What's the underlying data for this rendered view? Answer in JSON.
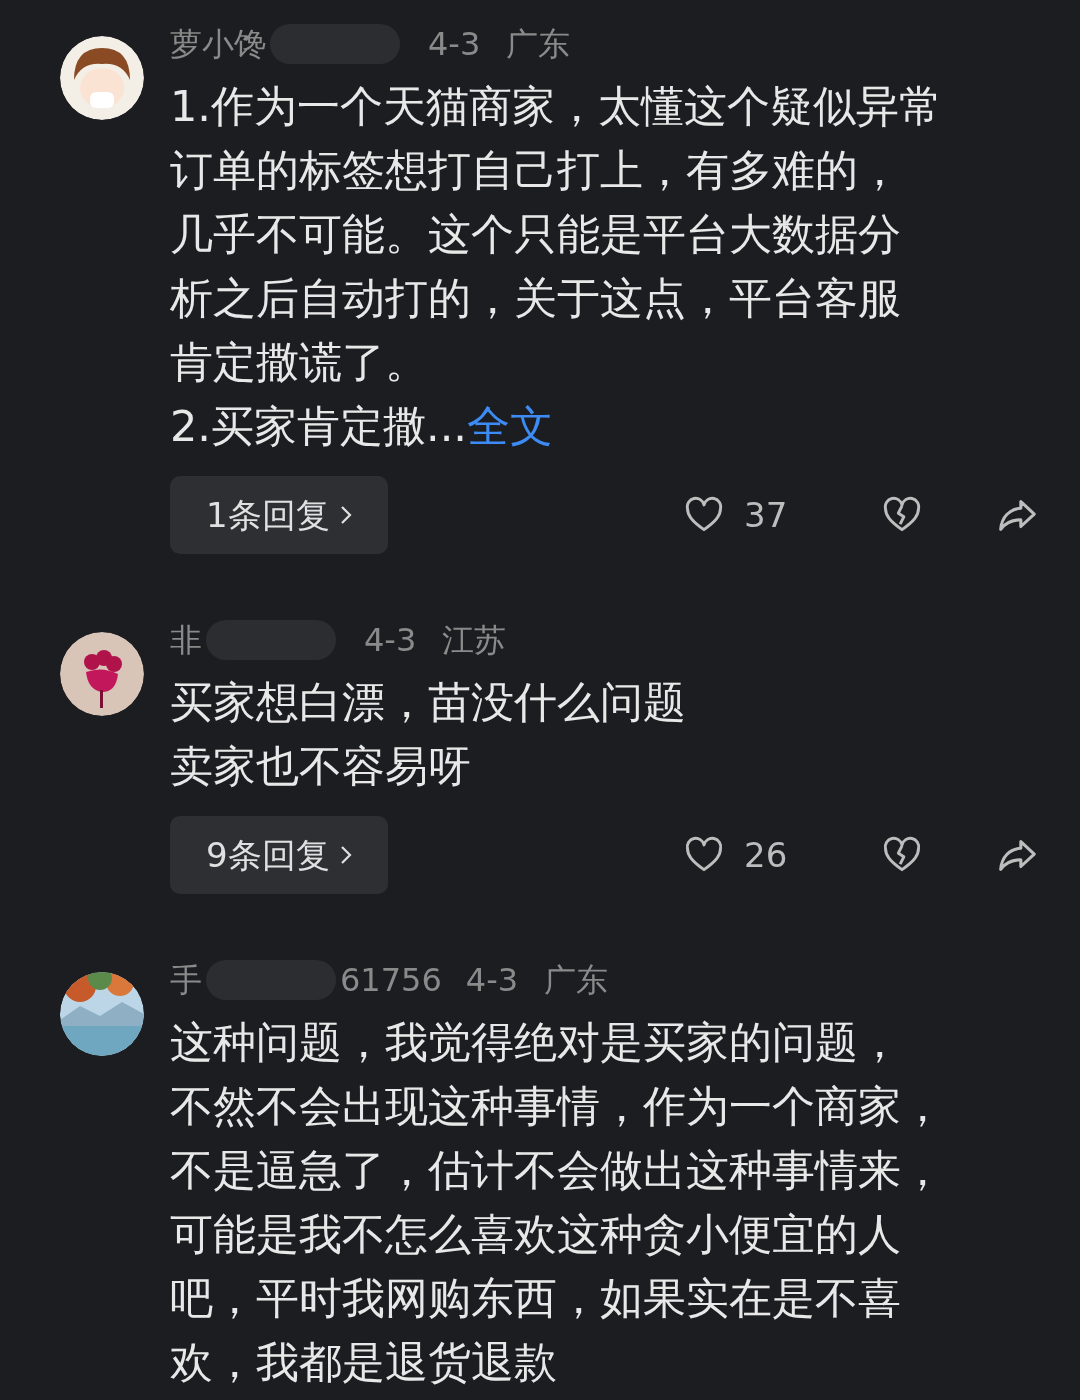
{
  "comments": [
    {
      "avatar": {
        "kind": "girl"
      },
      "user_name": "萝小馋",
      "date": "4-3",
      "region": "广东",
      "body_lines": [
        "1.作为一个天猫商家，太懂这个疑似异常",
        "订单的标签想打自己打上，有多难的，",
        "几乎不可能。这个只能是平台大数据分",
        "析之后自动打的，关于这点，平台客服",
        "肯定撒谎了。",
        "2.买家肯定撒..."
      ],
      "more_link": "全文",
      "replies": "1条回复",
      "likes": "37"
    },
    {
      "avatar": {
        "kind": "flower"
      },
      "user_name": "非",
      "date": "4-3",
      "region": "江苏",
      "body_lines": [
        "买家想白漂，苗没什么问题",
        "卖家也不容易呀"
      ],
      "replies": "9条回复",
      "likes": "26"
    },
    {
      "avatar": {
        "kind": "lake"
      },
      "user_name": "手",
      "user_suffix": "61756",
      "date": "4-3",
      "region": "广东",
      "body_lines": [
        "这种问题，我觉得绝对是买家的问题，",
        "不然不会出现这种事情，作为一个商家，",
        "不是逼急了，估计不会做出这种事情来，",
        "可能是我不怎么喜欢这种贪小便宜的人",
        "吧，平时我网购东西，如果实在是不喜",
        "欢，我都是退货退款"
      ]
    }
  ]
}
